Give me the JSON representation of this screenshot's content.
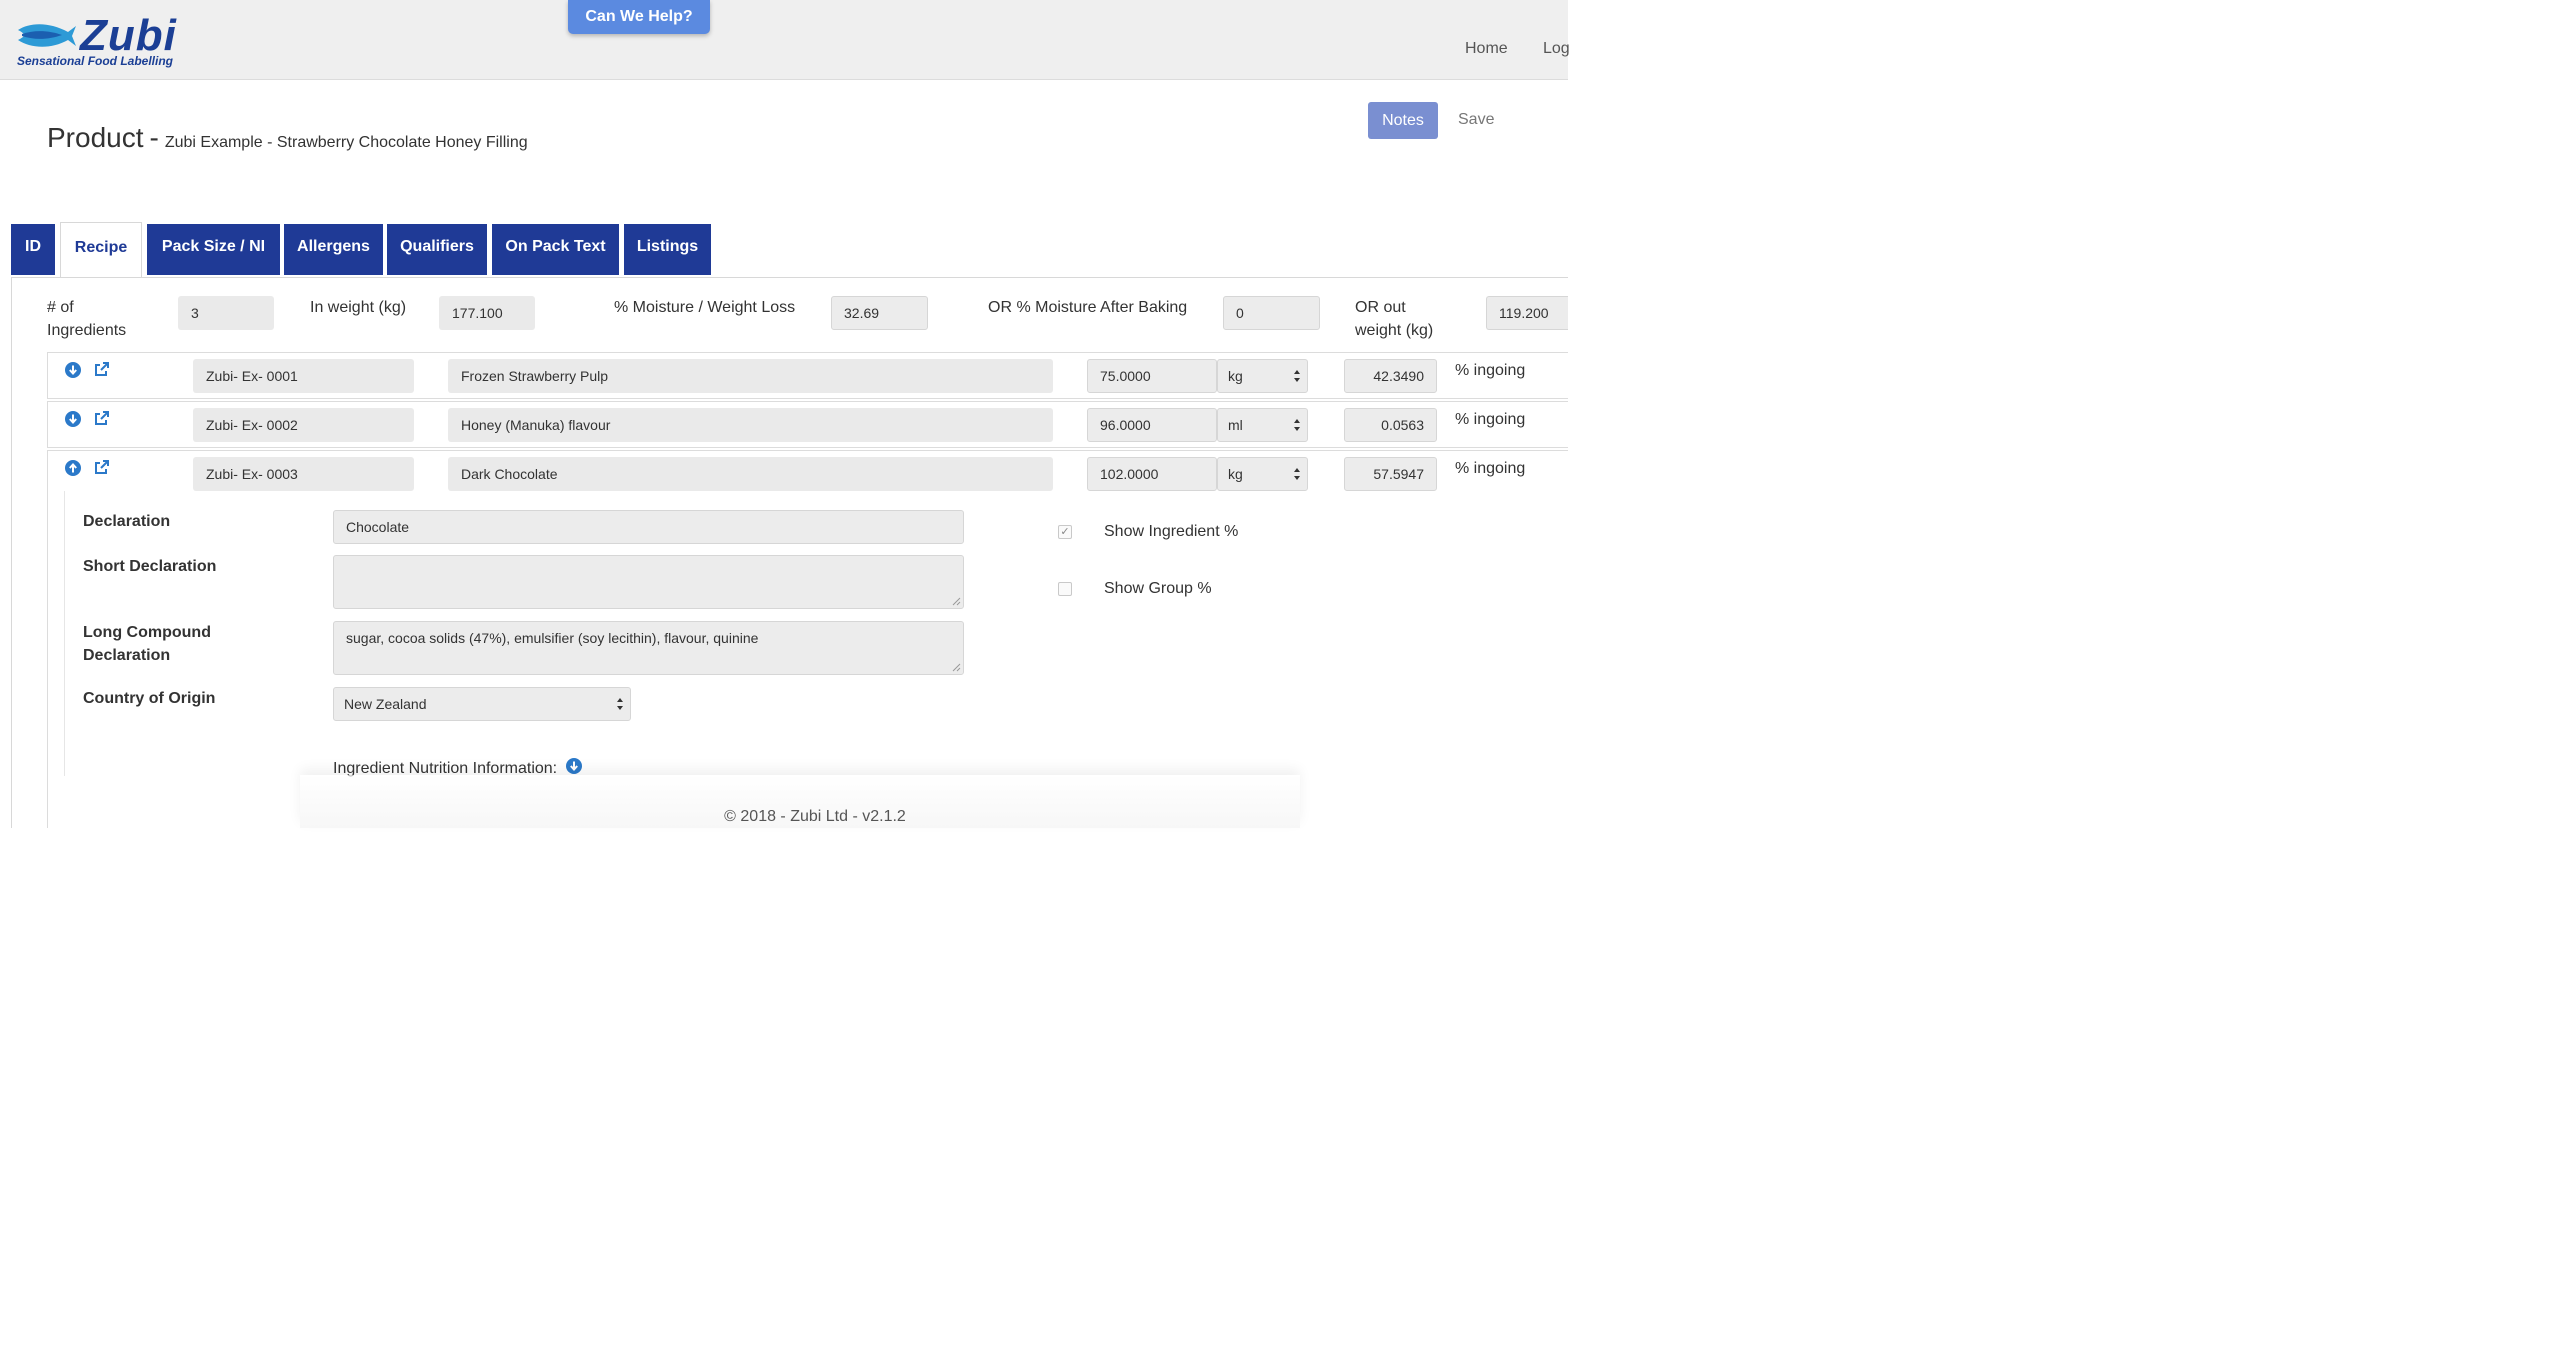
{
  "header": {
    "brand": "Zubi",
    "tagline": "Sensational Food Labelling",
    "help_button": "Can We Help?",
    "nav": {
      "home": "Home",
      "login": "Log"
    }
  },
  "product": {
    "label": "Product",
    "separator": "-",
    "name": "Zubi Example - Strawberry Chocolate Honey Filling",
    "notes_button": "Notes",
    "save_button": "Save"
  },
  "tabs": [
    {
      "label": "ID"
    },
    {
      "label": "Recipe"
    },
    {
      "label": "Pack Size / NI"
    },
    {
      "label": "Allergens"
    },
    {
      "label": "Qualifiers"
    },
    {
      "label": "On Pack Text"
    },
    {
      "label": "Listings"
    }
  ],
  "summary": {
    "num_ingredients_label_1": "# of",
    "num_ingredients_label_2": "Ingredients",
    "num_ingredients": "3",
    "in_weight_label": "In weight (kg)",
    "in_weight": "177.100",
    "moisture_label": "% Moisture / Weight Loss",
    "moisture": "32.69",
    "moisture_baking_label": "OR % Moisture After Baking",
    "moisture_baking": "0",
    "out_weight_label_1": "OR out",
    "out_weight_label_2": "weight (kg)",
    "out_weight": "119.200"
  },
  "ingredients": [
    {
      "code": "Zubi- Ex- 0001",
      "name": "Frozen Strawberry Pulp",
      "qty": "75.0000",
      "unit": "kg",
      "percent": "42.3490",
      "percent_label": "% ingoing"
    },
    {
      "code": "Zubi- Ex- 0002",
      "name": "Honey (Manuka) flavour",
      "qty": "96.0000",
      "unit": "ml",
      "percent": "0.0563",
      "percent_label": "% ingoing"
    },
    {
      "code": "Zubi- Ex- 0003",
      "name": "Dark Chocolate",
      "qty": "102.0000",
      "unit": "kg",
      "percent": "57.5947",
      "percent_label": "% ingoing"
    }
  ],
  "details": {
    "declaration_label": "Declaration",
    "declaration": "Chocolate",
    "short_declaration_label": "Short Declaration",
    "short_declaration": "",
    "long_declaration_label_1": "Long Compound",
    "long_declaration_label_2": "Declaration",
    "long_declaration": "sugar, cocoa solids (47%), emulsifier (soy lecithin), flavour, quinine",
    "country_label": "Country of Origin",
    "country": "New Zealand",
    "show_ingredient_pct_label": "Show Ingredient %",
    "show_ingredient_pct": true,
    "show_group_pct_label": "Show Group %",
    "show_group_pct": false,
    "nutrition_label": "Ingredient Nutrition Information:"
  },
  "footer": {
    "copyright": "© 2018 - Zubi Ltd - v2.1.2"
  },
  "colors": {
    "brand": "#1b3f95",
    "tab": "#1f3a96",
    "help": "#5b8ae0",
    "notes": "#7a8fd1",
    "icon": "#2b79c9"
  },
  "icons": [
    "fish-logo-icon",
    "arrow-down-circle-icon",
    "arrow-up-circle-icon",
    "external-link-icon",
    "select-arrows-icon",
    "checkmark-icon"
  ]
}
